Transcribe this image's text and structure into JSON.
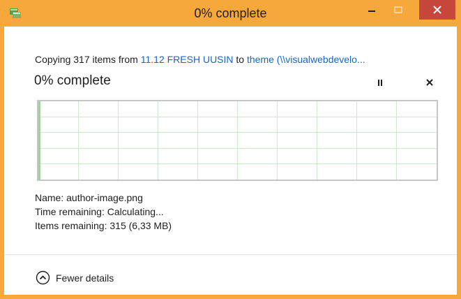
{
  "window": {
    "title": "0% complete",
    "accent_color": "#f6a93a",
    "close_color": "#c7473d"
  },
  "copy": {
    "prefix": "Copying 317 items from",
    "source": "11.12 FRESH UUSIN",
    "connector": "to",
    "destination": "theme (\\\\visualwebdevelo..."
  },
  "status": {
    "text": "0% complete",
    "progress_percent": 0
  },
  "details": {
    "name_label": "Name:",
    "name_value": "author-image.png",
    "time_label": "Time remaining:",
    "time_value": "Calculating...",
    "items_label": "Items remaining:",
    "items_value": "315 (6,33 MB)"
  },
  "footer": {
    "toggle_label": "Fewer details"
  },
  "icons": {
    "window": "file-copy-icon",
    "minimize": "minimize-icon",
    "maximize": "maximize-icon",
    "close": "close-icon",
    "pause": "pause-icon",
    "cancel": "cancel-icon",
    "fewer": "chevron-up-circle-icon"
  }
}
